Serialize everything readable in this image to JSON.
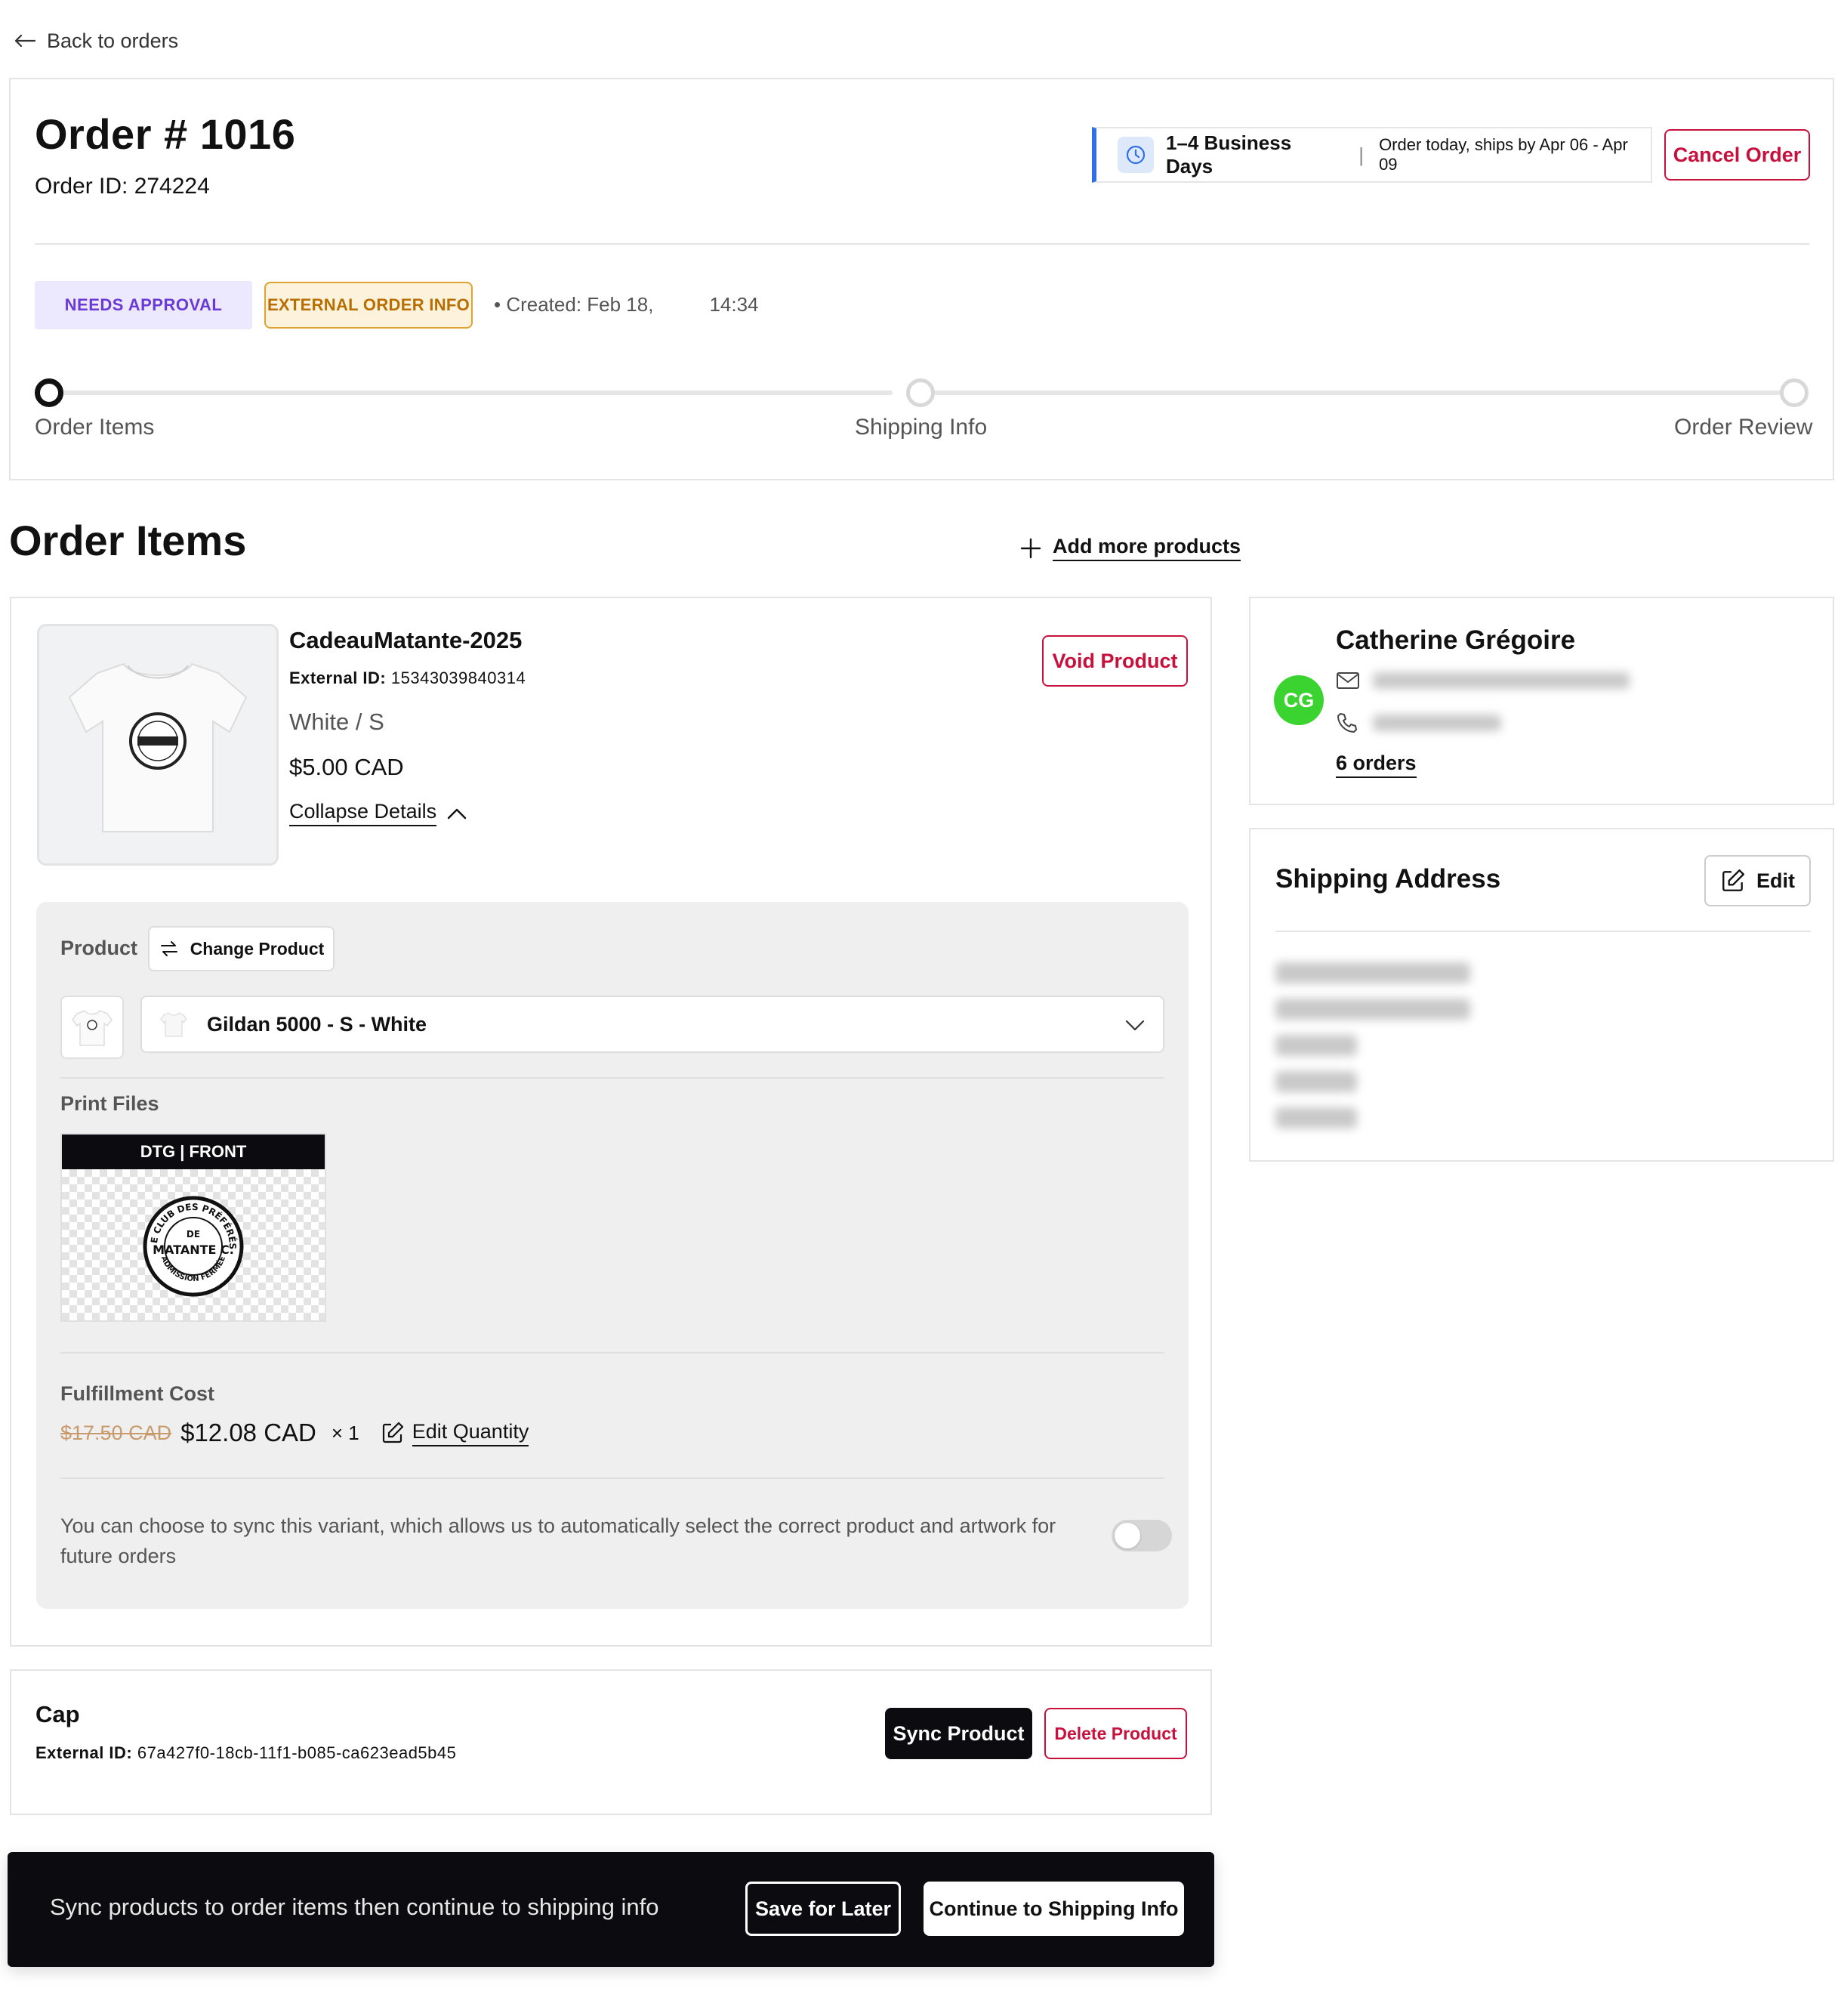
{
  "nav": {
    "back_label": "Back to orders"
  },
  "order": {
    "title": "Order # 1016",
    "order_id": "Order ID: 274224",
    "shipping": {
      "days": "1–4 Business Days",
      "separator": "|",
      "note": "Order today, ships by Apr 06 - Apr 09"
    },
    "cancel_label": "Cancel Order",
    "badges": {
      "approval": "NEEDS APPROVAL",
      "external": "EXTERNAL ORDER INFO"
    },
    "created_label": "• Created: Feb 18,",
    "created_time": "14:34",
    "steps": [
      {
        "label": "Order Items",
        "active": true
      },
      {
        "label": "Shipping Info",
        "active": false
      },
      {
        "label": "Order Review",
        "active": false
      }
    ]
  },
  "order_items": {
    "title": "Order Items",
    "add_more_label": "Add more products",
    "items": [
      {
        "name": "CadeauMatante-2025",
        "external_id_label": "External ID:",
        "external_id": "15343039840314",
        "variant": "White / S",
        "price": "$5.00 CAD",
        "collapse_label": "Collapse Details",
        "void_label": "Void Product",
        "product_label": "Product",
        "change_product_label": "Change Product",
        "selected_product": "Gildan 5000 - S - White",
        "print_files_label": "Print Files",
        "print_file_tag": "DTG | FRONT",
        "fulfillment_cost_label": "Fulfillment Cost",
        "old_cost": "$17.50 CAD",
        "new_cost": "$12.08 CAD",
        "quantity_text": "× 1",
        "edit_quantity_label": "Edit Quantity",
        "sync_note": "You can choose to sync this variant, which allows us to automatically select the correct product and artwork for future orders",
        "sync_enabled": false
      },
      {
        "name": "Cap",
        "external_id_label": "External ID:",
        "external_id": "67a427f0-18cb-11f1-b085-ca623ead5b45",
        "sync_label": "Sync Product",
        "delete_label": "Delete Product"
      }
    ]
  },
  "logo_text": {
    "top": "LE CLUB DES PRÉFÉRÉS",
    "mid1": "DE",
    "mid2": "MATANTE C.",
    "bottom": "ADMISSION FERMÉE"
  },
  "bottom_bar": {
    "message": "Sync products to order items then continue to shipping info",
    "save_label": "Save for Later",
    "continue_label": "Continue to Shipping Info"
  },
  "customer": {
    "name": "Catherine Grégoire",
    "initials": "CG",
    "orders_label": "6 orders",
    "avatar_color": "#3ad32f"
  },
  "shipping_address": {
    "title": "Shipping Address",
    "edit_label": "Edit"
  },
  "colors": {
    "danger": "#c8103c",
    "accent_blue": "#2f6fe8",
    "approval_bg": "#ece8fd",
    "approval_text": "#6a3ad6",
    "external_border": "#e0a230",
    "dark": "#0b0b10"
  }
}
